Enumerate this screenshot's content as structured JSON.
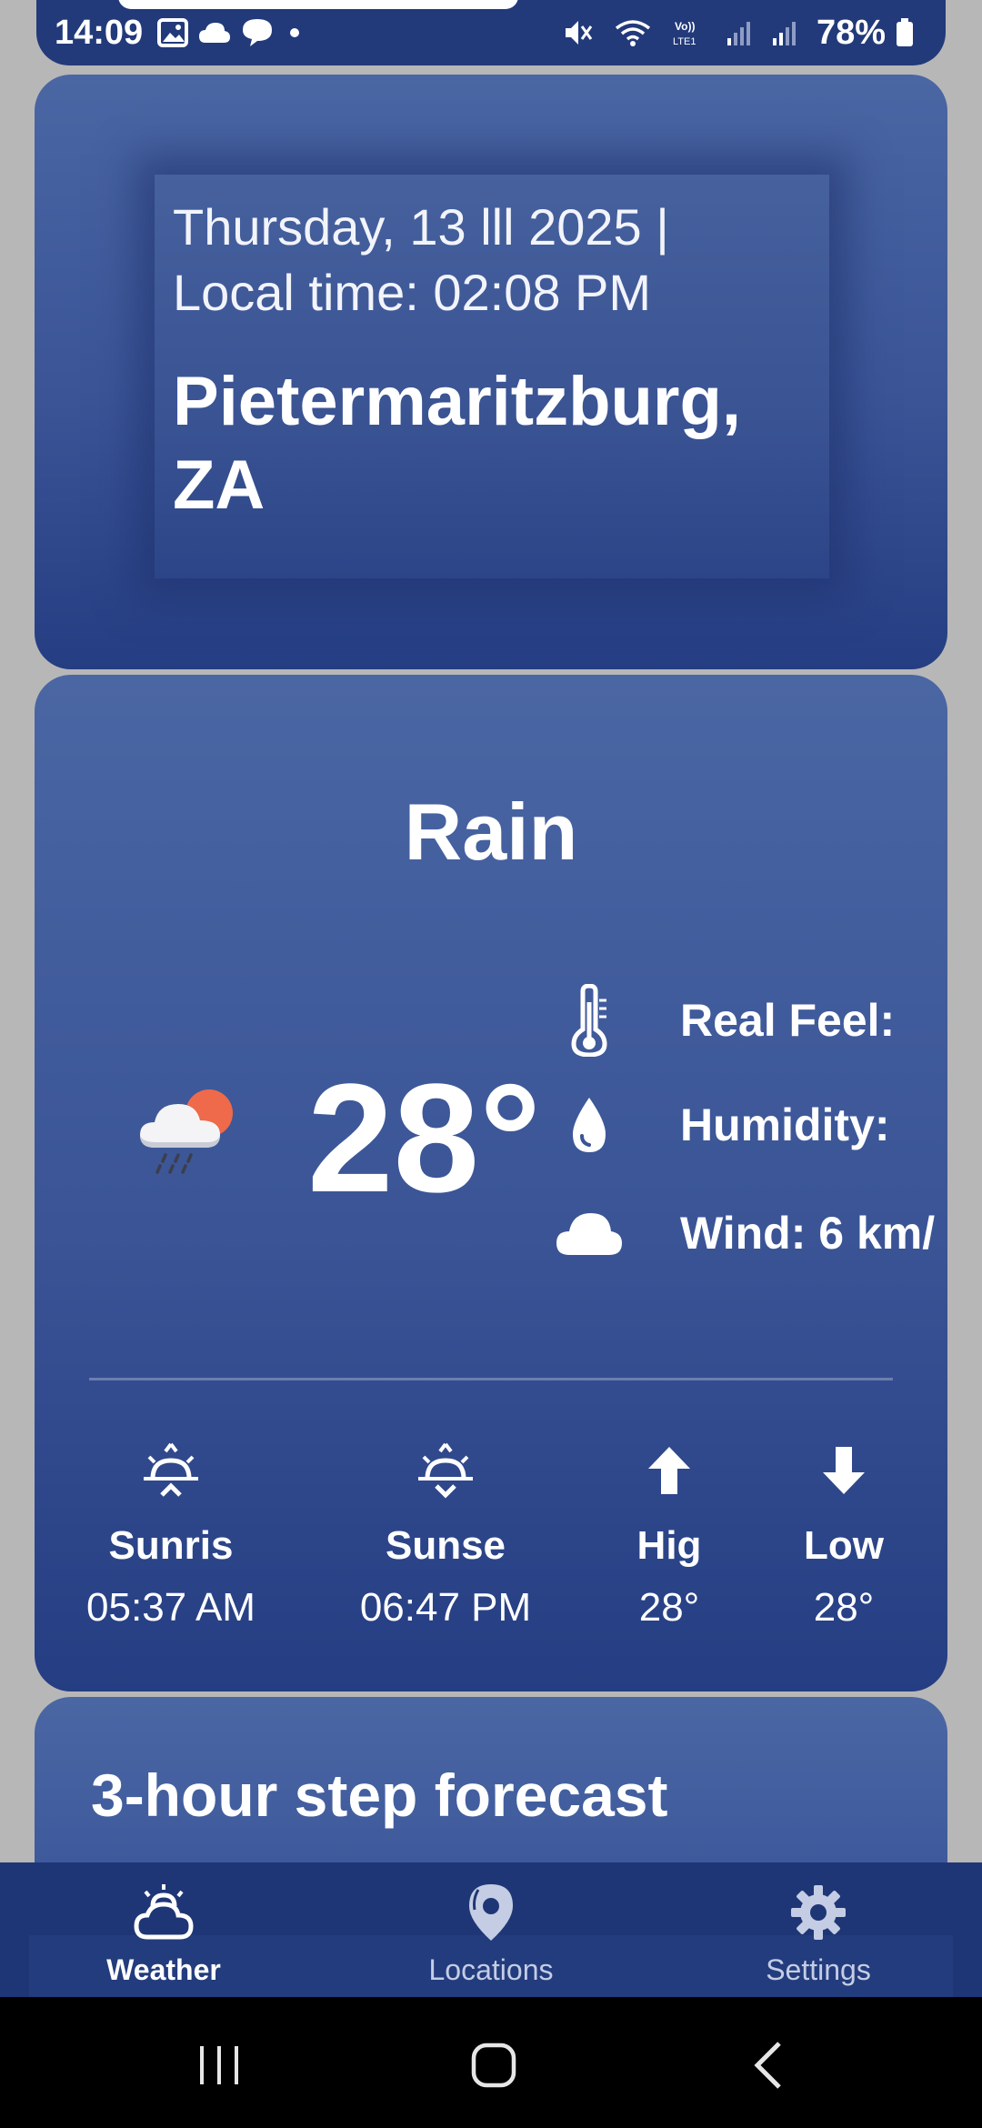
{
  "status_bar": {
    "time": "14:09",
    "battery": "78%"
  },
  "header": {
    "date_line_1": "Thursday, 13 lll 2025 |",
    "date_line_2": "Local time: 02:08 PM",
    "city_line_1": "Pietermaritzburg,",
    "city_line_2": "ZA"
  },
  "current": {
    "condition": "Rain",
    "temperature": "28°",
    "real_feel_label": "Real Feel:",
    "humidity_label": "Humidity:",
    "wind_label": "Wind: 6 km/"
  },
  "stats": {
    "sunrise_label": "Sunris",
    "sunrise_value": "05:37 AM",
    "sunset_label": "Sunse",
    "sunset_value": "06:47 PM",
    "high_label": "Hig",
    "high_value": "28°",
    "low_label": "Low",
    "low_value": "28°"
  },
  "forecast": {
    "title": "3-hour step forecast"
  },
  "bottom_nav": {
    "weather": "Weather",
    "locations": "Locations",
    "settings": "Settings"
  },
  "colors": {
    "card_top": "#4a66a3",
    "card_bottom": "#253d82",
    "nav_bg": "#1f3676",
    "sun": "#ee6a4a"
  }
}
